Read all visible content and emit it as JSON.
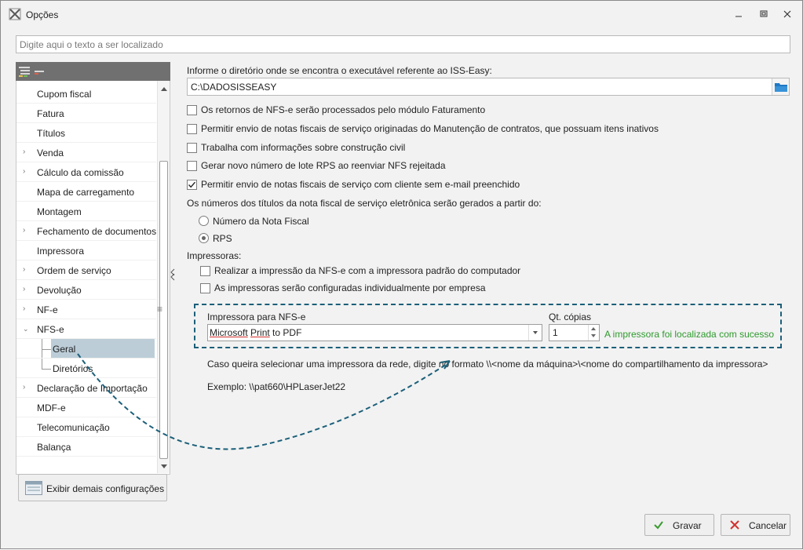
{
  "window": {
    "title": "Opções",
    "minimize_icon": "minimize-icon",
    "maximize_icon": "maximize-icon",
    "close_icon": "close-icon"
  },
  "search": {
    "placeholder": "Digite aqui o texto a ser localizado",
    "value": ""
  },
  "tree": {
    "items": [
      {
        "label": "Cupom fiscal",
        "expandable": false
      },
      {
        "label": "Fatura",
        "expandable": false
      },
      {
        "label": "Títulos",
        "expandable": false
      },
      {
        "label": "Venda",
        "expandable": true
      },
      {
        "label": "Cálculo da comissão",
        "expandable": true
      },
      {
        "label": "Mapa de carregamento",
        "expandable": false
      },
      {
        "label": "Montagem",
        "expandable": false
      },
      {
        "label": "Fechamento de documentos",
        "expandable": true
      },
      {
        "label": "Impressora",
        "expandable": false
      },
      {
        "label": "Ordem de serviço",
        "expandable": true
      },
      {
        "label": "Devolução",
        "expandable": true
      },
      {
        "label": "NF-e",
        "expandable": true
      },
      {
        "label": "NFS-e",
        "expanded": true
      },
      {
        "label": "Geral",
        "child": true,
        "selected": true
      },
      {
        "label": "Diretórios",
        "child": true
      },
      {
        "label": "Declaração de Importação",
        "expandable": true
      },
      {
        "label": "MDF-e",
        "expandable": false
      },
      {
        "label": "Telecomunicação",
        "expandable": false
      },
      {
        "label": "Balança",
        "expandable": false
      }
    ],
    "more_button": "Exibir demais configurações"
  },
  "main": {
    "dir_label": "Informe o diretório onde se encontra o executável referente ao ISS-Easy:",
    "dir_value": "C:\\DADOSISSEASY",
    "checkboxes": [
      {
        "label": "Os retornos de NFS-e serão processados pelo módulo Faturamento",
        "checked": false
      },
      {
        "label": "Permitir envio de notas fiscais de serviço originadas do Manutenção de contratos, que possuam itens inativos",
        "checked": false
      },
      {
        "label": "Trabalha com informações sobre construção civil",
        "checked": false
      },
      {
        "label": "Gerar novo número de lote RPS ao reenviar NFS rejeitada",
        "checked": false
      },
      {
        "label": "Permitir envio de notas fiscais de serviço com cliente sem e-mail preenchido",
        "checked": true
      }
    ],
    "numbers_label": "Os números dos títulos da nota fiscal de serviço eletrônica serão gerados a partir do:",
    "radios": [
      {
        "label": "Número da Nota Fiscal",
        "selected": false
      },
      {
        "label": "RPS",
        "selected": true
      }
    ],
    "printers_label": "Impressoras:",
    "printer_checkboxes": [
      {
        "label": "Realizar a impressão da NFS-e com a impressora padrão do computador",
        "checked": false
      },
      {
        "label": "As impressoras serão configuradas individualmente por empresa",
        "checked": false
      }
    ],
    "printer_field_label": "Impressora para NFS-e",
    "printer_value_word1": "Microsoft",
    "printer_value_word2": "Print",
    "printer_value_rest": " to PDF",
    "copies_label": "Qt. cópias",
    "copies_value": "1",
    "success_message": "A impressora foi localizada com sucesso",
    "hint": "Caso queira selecionar uma impressora da rede, digite no formato \\\\<nome da máquina>\\<nome do compartilhamento da impressora>",
    "example": "Exemplo: \\\\pat660\\HPLaserJet22"
  },
  "footer": {
    "save": "Gravar",
    "cancel": "Cancelar"
  },
  "colors": {
    "accent": "#1b5f79",
    "success": "#2e9a2e",
    "selected_row": "#bccdd8",
    "save_icon": "#3a9a2f",
    "cancel_icon": "#d0312d"
  }
}
